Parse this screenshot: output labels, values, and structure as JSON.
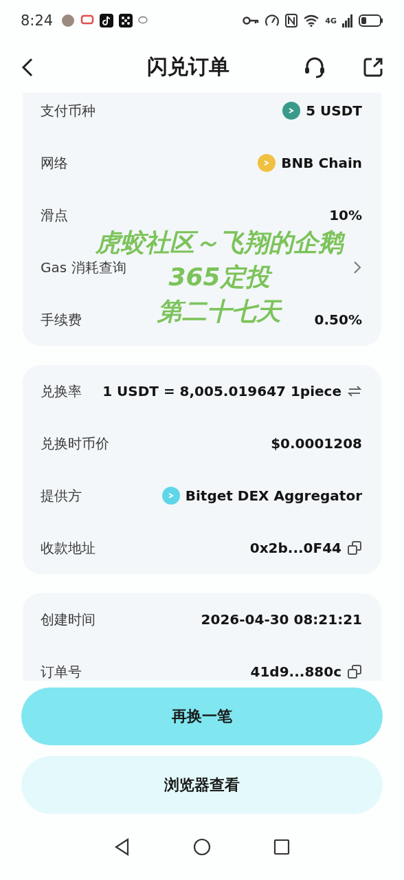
{
  "status_bar": {
    "time": "8:24",
    "network": "4G"
  },
  "header": {
    "title": "闪兑订单"
  },
  "cards": [
    {
      "rows": [
        {
          "kind": "token",
          "label": "支付币种",
          "value": "5 USDT",
          "color": "#3a9a8a"
        },
        {
          "kind": "token",
          "label": "网络",
          "value": "BNB Chain",
          "color": "#f0c040"
        },
        {
          "kind": "plain",
          "label": "滑点",
          "value": "10%"
        },
        {
          "kind": "link",
          "label": "Gas 消耗查询"
        },
        {
          "kind": "plain",
          "label": "手续费",
          "value": "0.50%"
        }
      ],
      "overlay_caption": [
        "虎蛟社区～飞翔的企鹅",
        "365定投",
        "第二十七天"
      ]
    },
    {
      "rows": [
        {
          "kind": "swap",
          "label": "兑换率",
          "value": "1 USDT = 8,005.019647 1piece"
        },
        {
          "kind": "plain",
          "label": "兑换时币价",
          "value": "$0.0001208"
        },
        {
          "kind": "token",
          "label": "提供方",
          "value": "Bitget DEX Aggregator",
          "color": "#5fd6e8"
        },
        {
          "kind": "copy",
          "label": "收款地址",
          "value": "0x2b...0F44"
        }
      ]
    },
    {
      "rows": [
        {
          "kind": "plain",
          "label": "创建时间",
          "value": "2026-04-30 08:21:21"
        },
        {
          "kind": "copy",
          "label": "订单号",
          "value": "41d9...880c"
        }
      ]
    }
  ],
  "buttons": [
    {
      "label": "再换一笔",
      "primary": true
    },
    {
      "label": "浏览器查看",
      "primary": false
    }
  ]
}
